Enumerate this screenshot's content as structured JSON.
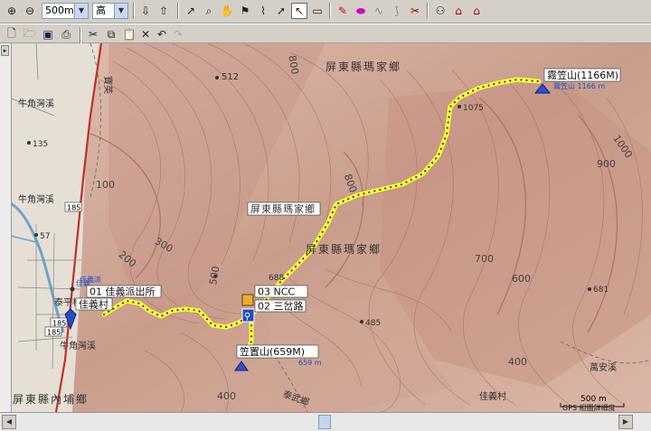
{
  "toolbar1": {
    "zoom_icon_in": "zoom-in-icon",
    "zoom_icon_out": "zoom-out-icon",
    "scale_value": "500m",
    "detail_value": "高"
  },
  "map": {
    "peaks": [
      {
        "label": "霧笠山(1166M)",
        "sub": "霧笠山 1166 m"
      },
      {
        "label": "笠置山(659M)",
        "sub": "659 m"
      }
    ],
    "waypoints": [
      {
        "label": "03 NCC"
      },
      {
        "label": "02 三岔路"
      },
      {
        "label": "01 佳義派出所"
      },
      {
        "label": "佳義村"
      },
      {
        "label": "佳義派"
      }
    ],
    "region_labels": [
      "屏東縣瑪家鄉",
      "屏東縣瑪家鄉",
      "屏東縣瑪家鄉",
      "屏東縣內埔鄉",
      "牛角灣溪",
      "牛角灣溪",
      "牛角灣溪",
      "泰平村",
      "佳義村",
      "萬安溪",
      "泰武鄉",
      "佳義",
      "寶英"
    ],
    "elevations": [
      "512",
      "800",
      "1075",
      "1000",
      "900",
      "800",
      "700",
      "600",
      "681",
      "500",
      "485",
      "400",
      "400",
      "300",
      "200",
      "100",
      "135",
      "57",
      "688",
      "185",
      "185",
      "185"
    ],
    "scale_bar": "500 m",
    "copyright": "GPS 組圖詳細度"
  }
}
